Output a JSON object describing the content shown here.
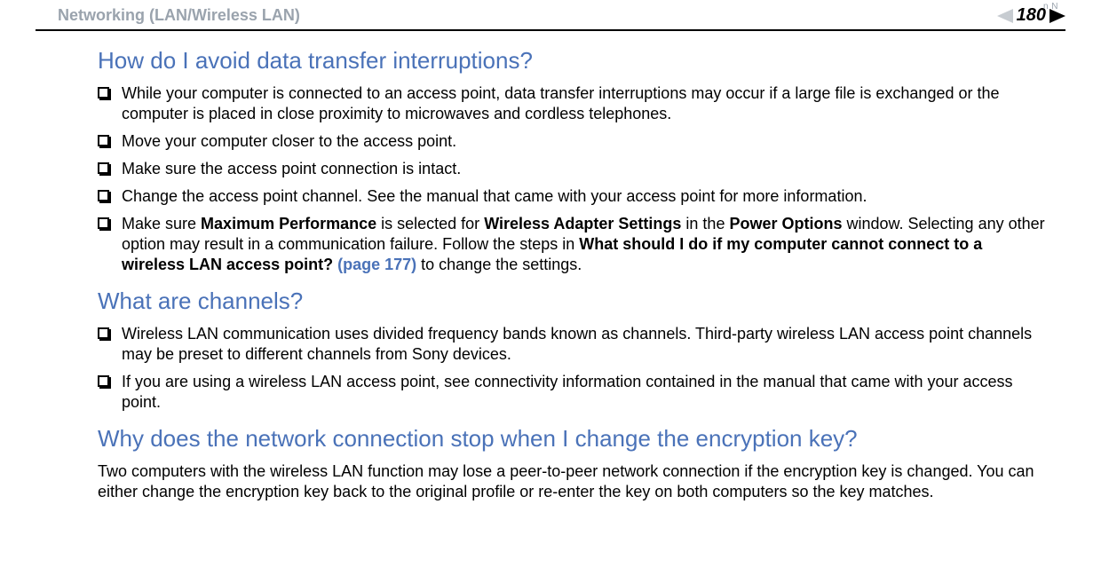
{
  "header": {
    "breadcrumb": "Networking (LAN/Wireless LAN)",
    "pageNumber": "180",
    "nLabel": "n N"
  },
  "sections": [
    {
      "heading": "How do I avoid data transfer interruptions?",
      "bullets": [
        {
          "plain": "While your computer is connected to an access point, data transfer interruptions may occur if a large file is exchanged or the computer is placed in close proximity to microwaves and cordless telephones."
        },
        {
          "plain": "Move your computer closer to the access point."
        },
        {
          "plain": "Make sure the access point connection is intact."
        },
        {
          "plain": "Change the access point channel. See the manual that came with your access point for more information."
        },
        {
          "runs": [
            {
              "t": "Make sure "
            },
            {
              "t": "Maximum Performance",
              "b": true
            },
            {
              "t": " is selected for "
            },
            {
              "t": "Wireless Adapter Settings",
              "b": true
            },
            {
              "t": " in the "
            },
            {
              "t": "Power Options",
              "b": true
            },
            {
              "t": " window. Selecting any other option may result in a communication failure. Follow the steps in "
            },
            {
              "t": "What should I do if my computer cannot connect to a wireless LAN access point? ",
              "b": true
            },
            {
              "t": "(page 177)",
              "link": true
            },
            {
              "t": " to change the settings."
            }
          ]
        }
      ]
    },
    {
      "heading": "What are channels?",
      "bullets": [
        {
          "plain": "Wireless LAN communication uses divided frequency bands known as channels. Third-party wireless LAN access point channels may be preset to different channels from Sony devices."
        },
        {
          "plain": "If you are using a wireless LAN access point, see connectivity information contained in the manual that came with your access point."
        }
      ]
    },
    {
      "heading": "Why does the network connection stop when I change the encryption key?",
      "paragraph": "Two computers with the wireless LAN function may lose a peer-to-peer network connection if the encryption key is changed. You can either change the encryption key back to the original profile or re-enter the key on both computers so the key matches."
    }
  ]
}
